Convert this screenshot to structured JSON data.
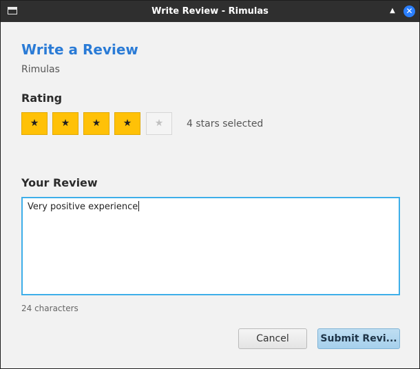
{
  "window": {
    "title": "Write Review - Rimulas",
    "collapse_icon": "▲",
    "close_icon": "✕"
  },
  "form": {
    "heading": "Write a Review",
    "subtitle": "Rimulas",
    "rating_label": "Rating",
    "rating_value": 4,
    "rating_max": 5,
    "star_glyph": "★",
    "rating_status": "4 stars selected",
    "review_label": "Your Review",
    "review_text": "Very positive experience",
    "char_count": "24 characters"
  },
  "buttons": {
    "cancel": "Cancel",
    "submit": "Submit Revi..."
  },
  "colors": {
    "accent": "#2a7bd6",
    "star_on": "#ffc107",
    "focus": "#3daee9"
  }
}
